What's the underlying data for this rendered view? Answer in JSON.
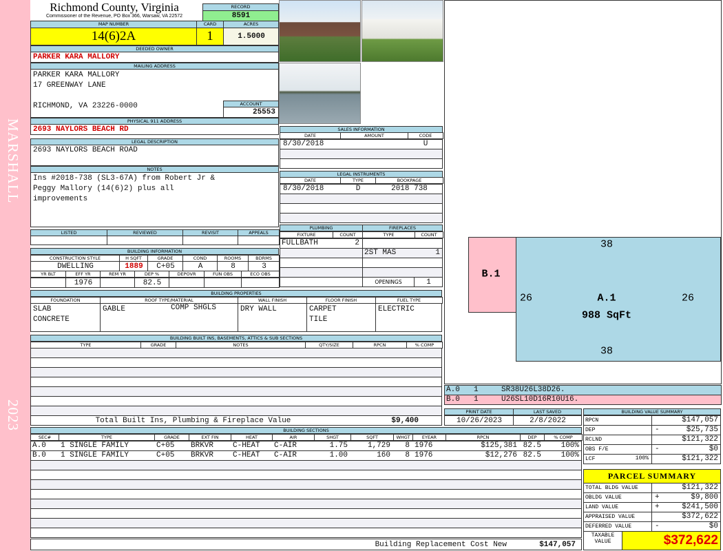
{
  "side": {
    "district": "MARSHALL",
    "year": "2023"
  },
  "header": {
    "county": "Richmond County, Virginia",
    "subtitle": "Commissioner of the Revenue, PO Box 366, Warsaw, VA 22572"
  },
  "record": {
    "label": "RECORD",
    "value": "8591"
  },
  "map": {
    "map_label": "MAP NUMBER",
    "map_value": "14(6)2A",
    "card_label": "CARD",
    "card_value": "1",
    "acres_label": "ACRES",
    "acres_value": "1.5000"
  },
  "owner": {
    "label": "DEEDED OWNER",
    "value": "PARKER KARA MALLORY"
  },
  "mailing": {
    "label": "MAILING ADDRESS",
    "lines": [
      "PARKER KARA MALLORY",
      "17 GREENWAY LANE",
      "",
      "RICHMOND, VA 23226-0000"
    ]
  },
  "account": {
    "label": "ACCOUNT",
    "value": "25553"
  },
  "physical": {
    "label": "PHYSICAL 911 ADDRESS",
    "value": "2693 NAYLORS BEACH RD"
  },
  "legal": {
    "label": "LEGAL DESCRIPTION",
    "value": "2693 NAYLORS BEACH ROAD"
  },
  "notes": {
    "label": "NOTES",
    "value": "Ins #2018-738 (SL3-67A) from Robert Jr &\nPeggy Mallory (14(6)2) plus all\nimprovements"
  },
  "review": {
    "headers": [
      "LISTED",
      "REVIEWED",
      "REVISIT",
      "APPEALS"
    ],
    "values": [
      "",
      "",
      "",
      ""
    ]
  },
  "building_info": {
    "label": "BUILDING INFORMATION",
    "headers1": [
      "CONSTRUCTION STYLE",
      "H SQFT",
      "GRADE",
      "COND",
      "ROOMS",
      "BDRMS"
    ],
    "values1": [
      "DWELLING",
      "1889",
      "C+05",
      "A",
      "8",
      "3"
    ],
    "headers2": [
      "YR BLT",
      "EFF YR",
      "REM YR",
      "DEP %",
      "DEPOVR",
      "FUN OBS",
      "ECO OBS"
    ],
    "values2": [
      "",
      "1976",
      "",
      "82.5",
      "",
      "",
      ""
    ]
  },
  "sales": {
    "label": "SALES INFORMATION",
    "headers": [
      "DATE",
      "AMOUNT",
      "CODE"
    ],
    "rows": [
      [
        "8/30/2018",
        "",
        "U"
      ]
    ]
  },
  "instruments": {
    "label": "LEGAL INSTRUMENTS",
    "headers": [
      "DATE",
      "TYPE",
      "BOOKPAGE"
    ],
    "rows": [
      [
        "8/30/2018",
        "D",
        "2018 738"
      ]
    ]
  },
  "plumbing": {
    "label": "PLUMBING",
    "headers": [
      "FIXTURE",
      "COUNT"
    ],
    "rows": [
      [
        "FULLBATH",
        "2"
      ]
    ]
  },
  "fireplaces": {
    "label": "FIREPLACES",
    "headers": [
      "TYPE",
      "COUNT"
    ],
    "rows": [
      [
        "",
        ""
      ],
      [
        "2ST MAS",
        "1"
      ]
    ],
    "openings_label": "OPENINGS",
    "openings_value": "1"
  },
  "properties": {
    "label": "BUILDING PROPERTIES",
    "headers": [
      "FOUNDATION",
      "ROOF TYPE/MATERIAL",
      "WALL FINISH",
      "FLOOR FINISH",
      "FUEL TYPE"
    ],
    "foundation": "SLAB\nCONCRETE",
    "roof_type": "GABLE",
    "roof_material": "COMP SHGLS",
    "wall": "DRY WALL",
    "floor": "CARPET\nTILE",
    "fuel": "ELECTRIC"
  },
  "builtins": {
    "label": "BUILDING BUILT INS, BASEMENTS, ATTICS & SUB SECTIONS",
    "headers": [
      "TYPE",
      "GRADE",
      "NOTES",
      "QTY/SIZE",
      "RPCN",
      "% COMP"
    ],
    "total_label": "Total Built Ins, Plumbing & Fireplace Value",
    "total_value": "$9,400"
  },
  "sections": {
    "label": "BUILDING SECTIONS",
    "headers": [
      "SEC#",
      "TYPE",
      "GRADE",
      "EXT FIN",
      "HEAT",
      "AIR",
      "SHGT",
      "SQFT",
      "WHGT",
      "EYEAR",
      "RPCN",
      "DEP",
      "% COMP"
    ],
    "rows": [
      [
        "A.0",
        "1 SINGLE FAMILY",
        "C+05",
        "BRKVR",
        "C-HEAT",
        "C-AIR",
        "1.75",
        "1,729",
        "8",
        "1976",
        "$125,381",
        "82.5",
        "100%"
      ],
      [
        "B.0",
        "1 SINGLE FAMILY",
        "C+05",
        "BRKVR",
        "C-HEAT",
        "C-AIR",
        "1.00",
        "160",
        "8",
        "1976",
        "$12,276",
        "82.5",
        "100%"
      ]
    ],
    "footer_label": "Building Replacement Cost New",
    "footer_value": "$147,057"
  },
  "sketch": {
    "a_label": "A.1",
    "a_area": "988 SqFt",
    "b_label": "B.1",
    "top": "38",
    "bottom": "38",
    "left": "26",
    "right": "26",
    "codes": [
      [
        "A.0",
        "1",
        "SR38U26L38D26."
      ],
      [
        "B.0",
        "1",
        "U26SL10D16R10U16."
      ]
    ]
  },
  "dates": {
    "print_label": "PRINT DATE",
    "print_value": "10/26/2023",
    "saved_label": "LAST SAVED",
    "saved_value": "2/8/2022"
  },
  "value_summary": {
    "label": "BUILDING VALUE SUMMARY",
    "rows": [
      [
        "RPCN",
        "",
        "",
        "$147,057"
      ],
      [
        "DEP",
        "",
        "-",
        "$25,735"
      ],
      [
        "RCLND",
        "",
        "",
        "$121,322"
      ],
      [
        "OBS F/E",
        "",
        "-",
        "$0"
      ],
      [
        "LCF",
        "100%",
        "",
        "$121,322"
      ]
    ]
  },
  "parcel": {
    "label": "PARCEL SUMMARY",
    "rows": [
      [
        "TOTAL BLDG VALUE",
        "",
        "$121,322"
      ],
      [
        "OBLDG VALUE",
        "+",
        "$9,800"
      ],
      [
        "LAND VALUE",
        "+",
        "$241,500"
      ],
      [
        "APPRAISED VALUE",
        "",
        "$372,622"
      ],
      [
        "DEFERRED VALUE",
        "-",
        "$0"
      ]
    ],
    "taxable_label": "TAXABLE\nVALUE",
    "taxable_value": "$372,622"
  },
  "colors": {
    "header": "#add8e6",
    "record": "#90ee90",
    "highlight": "#ffff00",
    "alert": "#d00000",
    "pink": "#ffc0cb"
  }
}
